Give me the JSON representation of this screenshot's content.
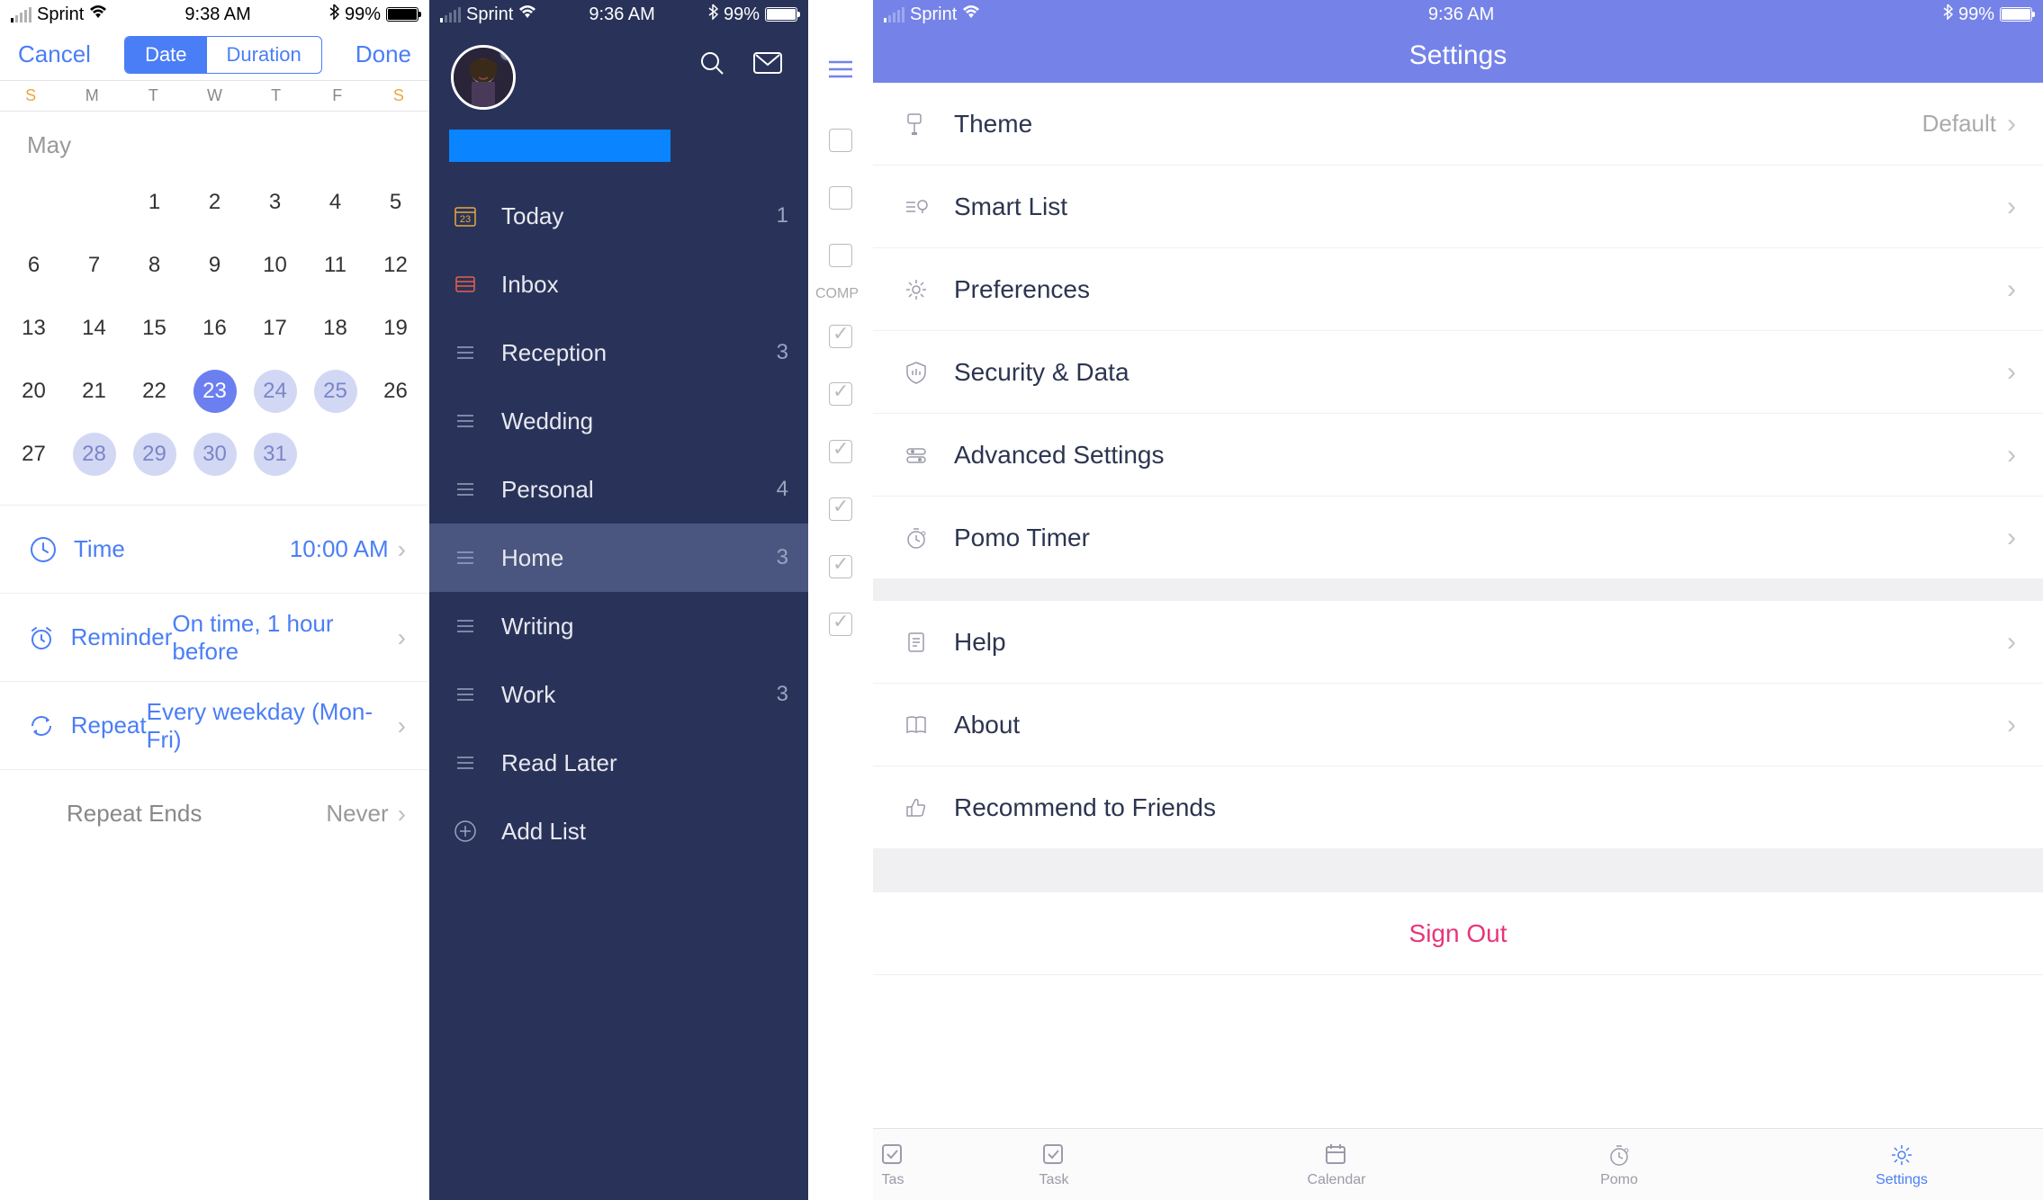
{
  "status": {
    "carrier": "Sprint",
    "time1": "9:38 AM",
    "time2": "9:36 AM",
    "time3": "9:36 AM",
    "battery": "99%"
  },
  "phone1": {
    "cancel": "Cancel",
    "done": "Done",
    "seg_date": "Date",
    "seg_duration": "Duration",
    "dow": [
      "S",
      "M",
      "T",
      "W",
      "T",
      "F",
      "S"
    ],
    "month": "May",
    "days": [
      "",
      "1",
      "2",
      "3",
      "4",
      "5",
      "6",
      "7",
      "8",
      "9",
      "10",
      "11",
      "12",
      "13",
      "14",
      "15",
      "16",
      "17",
      "18",
      "19",
      "20",
      "21",
      "22",
      "23",
      "24",
      "25",
      "26",
      "27",
      "28",
      "29",
      "30",
      "31"
    ],
    "options": {
      "time_label": "Time",
      "time_value": "10:00 AM",
      "reminder_label": "Reminder",
      "reminder_value": "On time, 1 hour before",
      "repeat_label": "Repeat",
      "repeat_value": "Every weekday (Mon-Fri)",
      "repeat_ends_label": "Repeat Ends",
      "repeat_ends_value": "Never"
    }
  },
  "phone2": {
    "items": [
      {
        "label": "Today",
        "count": "1",
        "icon": "calendar-today"
      },
      {
        "label": "Inbox",
        "count": "",
        "icon": "inbox"
      },
      {
        "label": "Reception",
        "count": "3",
        "icon": "list"
      },
      {
        "label": "Wedding",
        "count": "",
        "icon": "list"
      },
      {
        "label": "Personal",
        "count": "4",
        "icon": "list"
      },
      {
        "label": "Home",
        "count": "3",
        "icon": "list",
        "active": true
      },
      {
        "label": "Writing",
        "count": "",
        "icon": "list"
      },
      {
        "label": "Work",
        "count": "3",
        "icon": "list"
      },
      {
        "label": "Read Later",
        "count": "",
        "icon": "list"
      },
      {
        "label": "Add List",
        "count": "",
        "icon": "plus"
      }
    ]
  },
  "phone3": {
    "title": "Settings",
    "peek_label": "COMP",
    "rows1": [
      {
        "label": "Theme",
        "value": "Default",
        "icon": "paint"
      },
      {
        "label": "Smart List",
        "value": "",
        "icon": "bulb"
      },
      {
        "label": "Preferences",
        "value": "",
        "icon": "gear"
      },
      {
        "label": "Security & Data",
        "value": "",
        "icon": "shield"
      },
      {
        "label": "Advanced Settings",
        "value": "",
        "icon": "sliders"
      },
      {
        "label": "Pomo Timer",
        "value": "",
        "icon": "timer"
      }
    ],
    "rows2": [
      {
        "label": "Help",
        "value": "",
        "icon": "doc"
      },
      {
        "label": "About",
        "value": "",
        "icon": "book"
      },
      {
        "label": "Recommend to Friends",
        "value": "",
        "icon": "thumb",
        "nochev": true
      }
    ],
    "signout": "Sign Out",
    "tabs": [
      {
        "label": "Tas",
        "icon": "check",
        "cut": true
      },
      {
        "label": "Task",
        "icon": "check"
      },
      {
        "label": "Calendar",
        "icon": "calendar"
      },
      {
        "label": "Pomo",
        "icon": "timer"
      },
      {
        "label": "Settings",
        "icon": "gear",
        "active": true
      }
    ]
  }
}
